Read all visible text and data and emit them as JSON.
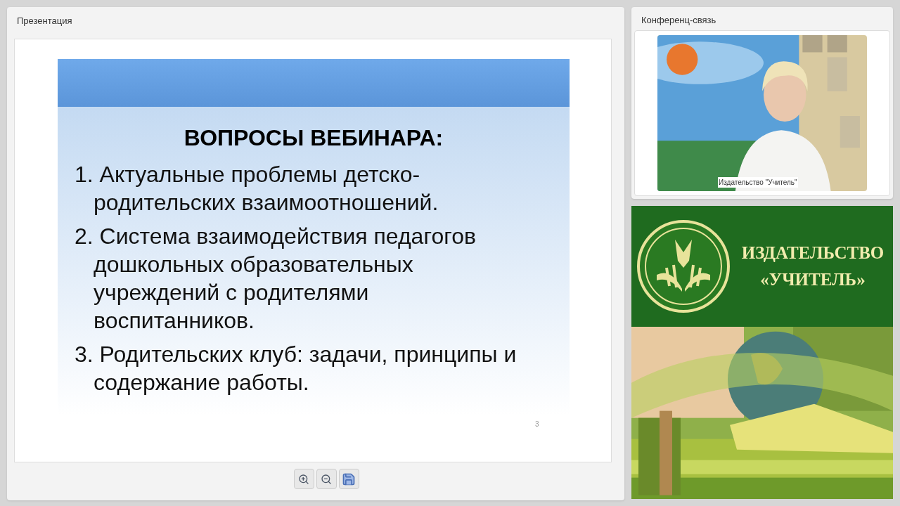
{
  "presentation": {
    "title": "Презентация",
    "slide": {
      "title": "ВОПРОСЫ ВЕБИНАРА:",
      "items": [
        {
          "number": "1.",
          "text": "Актуальные проблемы детско-родительских взаимоотношений."
        },
        {
          "number": "2.",
          "text": "Система взаимодействия педагогов дошкольных образовательных учреждений с родителями воспитанников."
        },
        {
          "number": "3.",
          "text": "Родительских клуб: задачи, принципы и содержание работы."
        }
      ],
      "page_number": "3"
    },
    "toolbar": [
      {
        "kind": "zoom-in"
      },
      {
        "kind": "zoom-out"
      },
      {
        "kind": "save"
      }
    ]
  },
  "conference": {
    "title": "Конференц-связь",
    "caption": "Издательство \"Учитель\""
  },
  "banner": {
    "line_1": "ИЗДАТЕЛЬСТВО",
    "line_2": "«УЧИТЕЛЬ»"
  }
}
